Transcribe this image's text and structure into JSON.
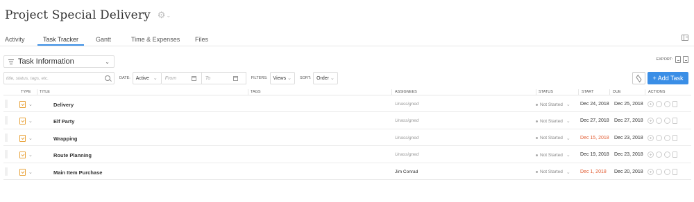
{
  "project": {
    "title": "Project Special Delivery"
  },
  "tabs": [
    {
      "label": "Activity",
      "active": false
    },
    {
      "label": "Task Tracker",
      "active": true
    },
    {
      "label": "Gantt",
      "active": false
    },
    {
      "label": "Time & Expenses",
      "active": false
    },
    {
      "label": "Files",
      "active": false
    }
  ],
  "view": {
    "label": "Task Information"
  },
  "export": {
    "label": "EXPORT:"
  },
  "filters": {
    "search_placeholder": "title, status, tags, etc.",
    "date_label": "DATE:",
    "date_value": "Active",
    "from_placeholder": "From",
    "to_placeholder": "To",
    "filters_label": "FILTERS:",
    "filters_value": "Views",
    "sort_label": "SORT:",
    "sort_value": "Order"
  },
  "add_task_label": "+ Add Task",
  "columns": {
    "type": "TYPE",
    "title": "TITLE",
    "tags": "TAGS",
    "assignees": "ASSIGNEES",
    "status": "STATUS",
    "start": "START",
    "due": "DUE",
    "actions": "ACTIONS"
  },
  "tasks": [
    {
      "title": "Delivery",
      "assignee": "Unassigned",
      "status": "Not Started",
      "start": "Dec 24, 2018",
      "due": "Dec 25, 2018"
    },
    {
      "title": "Elf Party",
      "assignee": "Unassigned",
      "status": "Not Started",
      "start": "Dec 27, 2018",
      "due": "Dec 27, 2018"
    },
    {
      "title": "Wrapping",
      "assignee": "Unassigned",
      "status": "Not Started",
      "start": "Dec 15, 2018",
      "due": "Dec 23, 2018"
    },
    {
      "title": "Route Planning",
      "assignee": "Unassigned",
      "status": "Not Started",
      "start": "Dec 19, 2018",
      "due": "Dec 23, 2018"
    },
    {
      "title": "Main Item Purchase",
      "assignee": "Jim Conrad",
      "status": "Not Started",
      "start": "Dec 1, 2018",
      "due": "Dec 20, 2018"
    }
  ],
  "colors": {
    "accent": "#3a8ee6",
    "overdue": "#e25d33",
    "task_icon": "#e8a33b"
  }
}
